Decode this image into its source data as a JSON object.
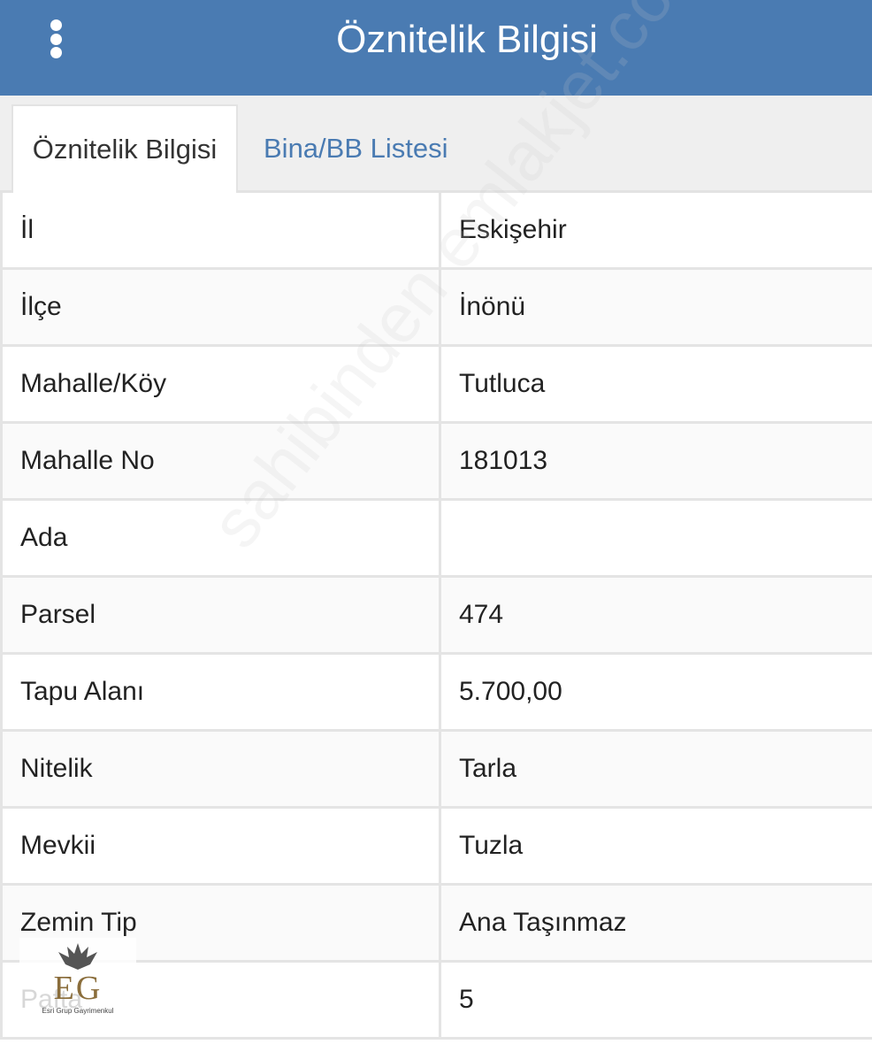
{
  "header": {
    "title": "Öznitelik Bilgisi",
    "menu_icon": "vertical-dots-icon"
  },
  "tabs": [
    {
      "label": "Öznitelik Bilgisi",
      "active": true
    },
    {
      "label": "Bina/BB Listesi",
      "active": false
    }
  ],
  "rows": [
    {
      "label": "İl",
      "value": "Eskişehir"
    },
    {
      "label": "İlçe",
      "value": "İnönü"
    },
    {
      "label": "Mahalle/Köy",
      "value": "Tutluca"
    },
    {
      "label": "Mahalle No",
      "value": "181013"
    },
    {
      "label": "Ada",
      "value": ""
    },
    {
      "label": "Parsel",
      "value": "474"
    },
    {
      "label": "Tapu Alanı",
      "value": "5.700,00"
    },
    {
      "label": "Nitelik",
      "value": "Tarla"
    },
    {
      "label": "Mevkii",
      "value": "Tuzla"
    },
    {
      "label": "Zemin Tip",
      "value": "Ana Taşınmaz"
    },
    {
      "label": "Pafta",
      "value": "5"
    }
  ],
  "watermark": "sahibinden emlakjet.com",
  "logo": {
    "letters": "EG",
    "subtitle": "Esri Grup Gayrimenkul"
  },
  "colors": {
    "header_bg": "#4a7bb2",
    "tab_link": "#4a7bb2",
    "border": "#e4e4e4"
  }
}
